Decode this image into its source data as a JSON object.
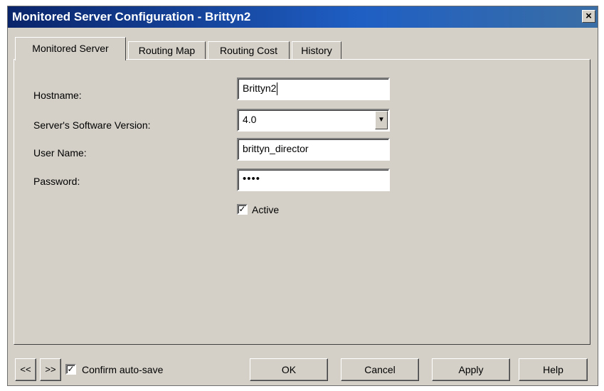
{
  "window": {
    "title": "Monitored Server Configuration - Brittyn2",
    "close_label": "×"
  },
  "tabs": [
    {
      "label": "Monitored Server",
      "active": true
    },
    {
      "label": "Routing Map",
      "active": false
    },
    {
      "label": "Routing Cost",
      "active": false
    },
    {
      "label": "History",
      "active": false
    }
  ],
  "form": {
    "hostname_label": "Hostname:",
    "hostname_value": "Brittyn2",
    "version_label": "Server's Software Version:",
    "version_value": "4.0",
    "username_label": "User Name:",
    "username_value": "brittyn_director",
    "password_label": "Password:",
    "password_value": "••••",
    "active_label": "Active",
    "active_checked": true,
    "check_mark": "✓"
  },
  "footer": {
    "prev_label": "<<",
    "next_label": ">>",
    "autosave_label": "Confirm auto-save",
    "autosave_checked": true,
    "ok_label": "OK",
    "cancel_label": "Cancel",
    "apply_label": "Apply",
    "help_label": "Help"
  },
  "icons": {
    "dropdown_arrow": "▼"
  },
  "colors": {
    "titlebar": "#0a246a",
    "dialog_bg": "#d4d0c8",
    "field_bg": "#ffffff"
  }
}
